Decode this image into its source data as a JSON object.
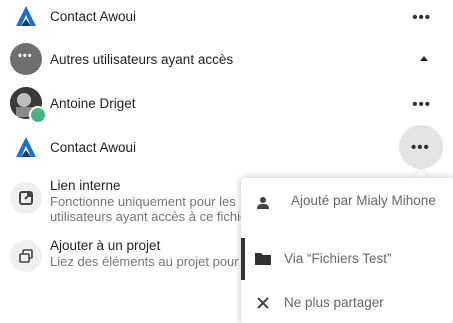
{
  "shares": [
    {
      "name": "Contact Awoui",
      "actions_icon": "more-horizontal-icon"
    },
    {
      "name": "Autres utilisateurs ayant accès",
      "toggle_icon": "triangle-up-icon"
    },
    {
      "name": "Antoine Driget",
      "actions_icon": "more-horizontal-icon",
      "status_color": "#49b382"
    },
    {
      "name": "Contact Awoui",
      "actions_icon": "more-horizontal-icon"
    }
  ],
  "internal_link": {
    "title": "Lien interne",
    "description": "Fonctionne uniquement pour les utilisateurs ayant accès à ce fichier",
    "icon": "external-link-icon"
  },
  "project": {
    "title": "Ajouter à un projet",
    "description": "Liez des éléments au projet pour",
    "icon": "projects-icon"
  },
  "menu": {
    "added_by": "Ajouté par Mialy Mihone",
    "via": "Via “Fichiers Test”",
    "unshare": "Ne plus partager"
  },
  "colors": {
    "logo_blue": "#1a6fd1",
    "gray_avatar": "#6f6f6f",
    "active_button_bg": "#e3e3e3"
  }
}
